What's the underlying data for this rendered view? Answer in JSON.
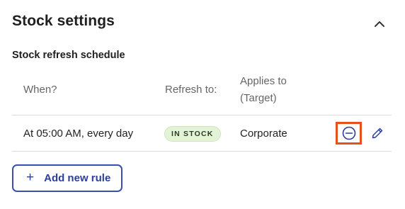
{
  "section": {
    "title": "Stock settings",
    "collapse_icon": "chevron-up-icon"
  },
  "schedule": {
    "subtitle": "Stock refresh schedule",
    "columns": {
      "when": "When?",
      "refresh_to": "Refresh to:",
      "applies_to_line1": "Applies to",
      "applies_to_line2": "(Target)"
    },
    "rows": [
      {
        "when": "At 05:00 AM, every day",
        "refresh_to": "IN STOCK",
        "applies_to": "Corporate",
        "remove_icon": "minus-circle-icon",
        "edit_icon": "pencil-icon"
      }
    ]
  },
  "add_rule": {
    "plus": "+",
    "label": "Add new rule"
  },
  "colors": {
    "accent": "#2d3e9e",
    "highlight_outline": "#e5501b",
    "badge_bg": "#e3f3d6"
  }
}
